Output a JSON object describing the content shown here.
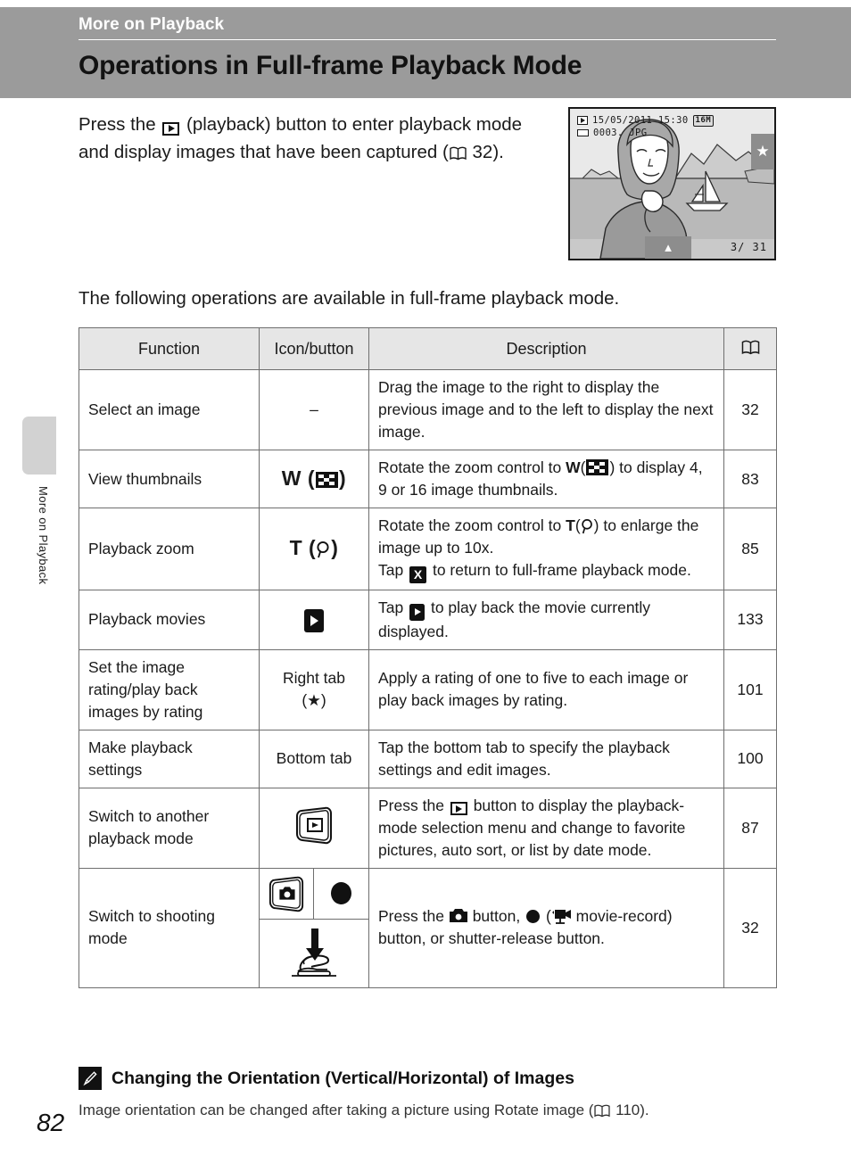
{
  "header": {
    "chapter": "More on Playback",
    "title": "Operations in Full-frame Playback Mode"
  },
  "side_tab": {
    "label": "More on Playback"
  },
  "page_number": "82",
  "intro": {
    "text_before_icon": "Press the",
    "play_icon": "playback-button-icon",
    "text_after_icon": "(playback) button to enter playback mode and display images that have been captured (",
    "ref_page": "32",
    "text_end": ")."
  },
  "camera_screen": {
    "mode_icon": "playback-icon",
    "datetime": "15/05/2011  15:30",
    "image_size": "16",
    "image_size_sub": "M",
    "battery_icon": "battery-icon",
    "filename": "0003. JPG",
    "rating_tab_icon": "★",
    "bottom_tab_icon": "▲",
    "frame_counter": "3/   31"
  },
  "lead_text": "The following operations are available in full-frame playback mode.",
  "table": {
    "headers": [
      "Function",
      "Icon/button",
      "Description",
      "book-icon"
    ],
    "rows": [
      {
        "function": "Select an image",
        "icon_text": "–",
        "description": "Drag the image to the right to display the previous image and to the left to display the next image.",
        "page": "32"
      },
      {
        "function": "View thumbnails",
        "icon_text": "W",
        "description_1": "Rotate the zoom control to",
        "description_2": "W",
        "description_3": ") to display 4, 9 or 16 image thumbnails.",
        "page": "83"
      },
      {
        "function": "Playback zoom",
        "icon_text": "T",
        "description_1": "Rotate the zoom control to",
        "description_2": "T",
        "description_3": ") to enlarge the image up to 10x.",
        "description_4": "Tap",
        "description_5": "to return to full-frame playback mode.",
        "page": "85"
      },
      {
        "function": "Playback movies",
        "icon_name": "movie-play-icon",
        "description_1": "Tap",
        "description_2": "to play back the movie currently displayed.",
        "page": "133"
      },
      {
        "function": "Set the image rating/play back images by rating",
        "icon_text": "Right tab",
        "icon_sub": "(★)",
        "description": "Apply a rating of one to five to each image or play back images by rating.",
        "page": "101"
      },
      {
        "function": "Make playback settings",
        "icon_text": "Bottom tab",
        "description": "Tap the bottom tab to specify the playback settings and edit images.",
        "page": "100"
      },
      {
        "function": "Switch to another playback mode",
        "icon_name": "playback-mode-button-icon",
        "description_1": "Press the",
        "description_2": "button to display the playback-mode selection menu and change to favorite pictures, auto sort, or list by date mode.",
        "page": "87"
      },
      {
        "function": "Switch to shooting mode",
        "icon_name_a": "camera-button-icon",
        "icon_name_b": "record-button-icon",
        "icon_name_c": "shutter-press-icon",
        "description_1": "Press the",
        "description_2": "button,",
        "description_3": "(",
        "description_4": "movie-record) button, or shutter-release button.",
        "page": "32"
      }
    ]
  },
  "footnote": {
    "icon": "pencil-note-icon",
    "title": "Changing the Orientation (Vertical/Horizontal) of Images",
    "body_before": "Image orientation can be changed after taking a picture using Rotate image (",
    "body_ref": "110",
    "body_after": ")."
  }
}
